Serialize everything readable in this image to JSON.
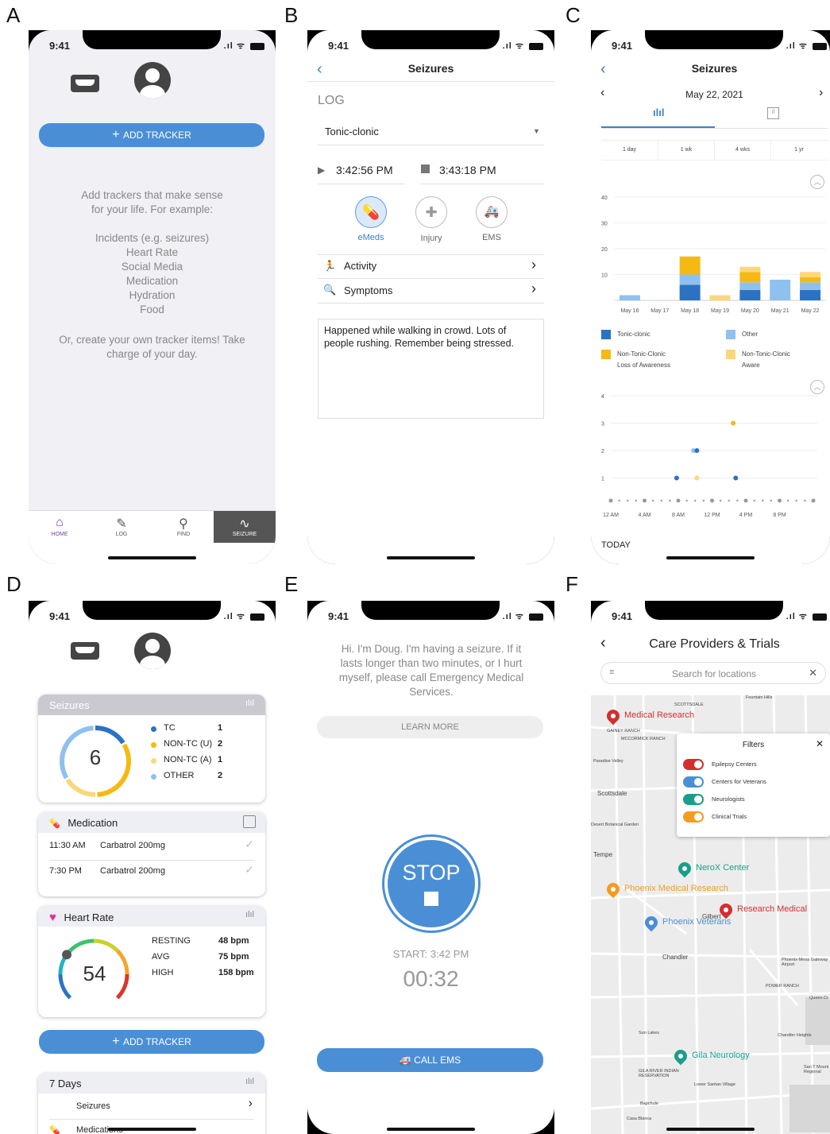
{
  "panels": {
    "a": "A",
    "b": "B",
    "c": "C",
    "d": "D",
    "e": "E",
    "f": "F"
  },
  "status": {
    "time": "9:41"
  },
  "screenA": {
    "add_tracker": "ADD TRACKER",
    "intro": "Add trackers that make sense",
    "intro2": "for your life. For example:",
    "examples": [
      "Incidents (e.g. seizures)",
      "Heart Rate",
      "Social Media",
      "Medication",
      "Hydration",
      "Food"
    ],
    "outro": "Or, create your own tracker items! Take",
    "outro2": "charge of your day.",
    "tabs": [
      "HOME",
      "LOG",
      "FIND",
      "SEIZURE"
    ]
  },
  "screenB": {
    "title": "Seizures",
    "log": "LOG",
    "type": "Tonic-clonic",
    "start": "3:42:56  PM",
    "end": "3:43:18  PM",
    "buttons": [
      "eMeds",
      "Injury",
      "EMS"
    ],
    "rows": [
      "Activity",
      "Symptoms"
    ],
    "note": "Happened while walking in crowd. Lots of people rushing. Remember being stressed."
  },
  "screenC": {
    "title": "Seizures",
    "date": "May 22, 2021",
    "ranges": [
      "1 day",
      "1 wk",
      "4 wks",
      "1 yr"
    ],
    "today": "TODAY",
    "legend": [
      {
        "label": "Tonic-clonic",
        "color": "#2b73c2"
      },
      {
        "label": "Other",
        "color": "#8ec1ee"
      },
      {
        "label": "Non-Tonic-Clonic",
        "label2": "Loss of Awareness",
        "color": "#f5b914"
      },
      {
        "label": "Non-Tonic-Clonic",
        "label2": "Aware",
        "color": "#fbd77c"
      }
    ]
  },
  "chart_data": [
    {
      "type": "bar",
      "categories": [
        "May 16",
        "May 17",
        "May 18",
        "May 19",
        "May 20",
        "May 21",
        "May 22"
      ],
      "ylim": [
        0,
        40
      ],
      "yticks": [
        10,
        20,
        30,
        40
      ],
      "series": [
        {
          "name": "Tonic-clonic",
          "values": [
            0,
            0,
            6,
            0,
            4,
            0,
            4
          ]
        },
        {
          "name": "Other",
          "values": [
            2,
            0,
            4,
            0,
            3,
            8,
            3
          ]
        },
        {
          "name": "Non-Tonic-Clonic Loss of Awareness",
          "values": [
            0,
            0,
            7,
            0,
            4,
            0,
            2
          ]
        },
        {
          "name": "Non-Tonic-Clonic Aware",
          "values": [
            0,
            0,
            0,
            2,
            2,
            0,
            2
          ]
        }
      ]
    },
    {
      "type": "scatter",
      "xticks": [
        "12 AM",
        "4 AM",
        "8 AM",
        "12 PM",
        "4 PM",
        "8 PM"
      ],
      "ylim": [
        0,
        4
      ],
      "yticks": [
        1,
        2,
        3,
        4
      ],
      "points": [
        {
          "x": 7.8,
          "y": 1,
          "series": "Tonic-clonic"
        },
        {
          "x": 10.2,
          "y": 1,
          "series": "Non-Tonic-Clonic Aware"
        },
        {
          "x": 9.8,
          "y": 2,
          "series": "Other"
        },
        {
          "x": 10.2,
          "y": 2,
          "series": "Tonic-clonic"
        },
        {
          "x": 14.5,
          "y": 3,
          "series": "Non-Tonic-Clonic Loss of Awareness"
        },
        {
          "x": 14.8,
          "y": 1,
          "series": "Tonic-clonic"
        }
      ]
    }
  ],
  "screenD": {
    "seizures": "Seizures",
    "seizure_count": "6",
    "seizure_rows": [
      {
        "label": "TC",
        "value": "1",
        "color": "#2b73c2"
      },
      {
        "label": "NON-TC (U)",
        "value": "2",
        "color": "#f5b914"
      },
      {
        "label": "NON-TC (A)",
        "value": "1",
        "color": "#fbd77c"
      },
      {
        "label": "OTHER",
        "value": "2",
        "color": "#8ec1ee"
      }
    ],
    "medication": "Medication",
    "meds": [
      {
        "time": "11:30 AM",
        "name": "Carbatrol 200mg"
      },
      {
        "time": "7:30 PM",
        "name": "Carbatrol 200mg"
      }
    ],
    "heart_rate": "Heart Rate",
    "hr_value": "54",
    "hr_rows": [
      {
        "label": "RESTING",
        "value": "48 bpm"
      },
      {
        "label": "AVG",
        "value": "75 bpm"
      },
      {
        "label": "HIGH",
        "value": "158 bpm"
      }
    ],
    "add_tracker": "ADD TRACKER",
    "seven_days": "7 Days",
    "seven_rows": [
      "Seizures",
      "Medications"
    ]
  },
  "screenE": {
    "message": "Hi. I'm Doug. I'm having a seizure. If it lasts longer than two minutes, or I hurt myself, please call Emergency Medical Services.",
    "learn_more": "LEARN MORE",
    "stop": "STOP",
    "start": "START: 3:42 PM",
    "timer": "00:32",
    "call": "CALL EMS"
  },
  "screenF": {
    "title": "Care Providers & Trials",
    "search_placeholder": "Search for locations",
    "filters_title": "Filters",
    "filters": [
      {
        "label": "Epilepsy Centers",
        "color": "#d32f2f"
      },
      {
        "label": "Centers for Veterans",
        "color": "#4a8fd6"
      },
      {
        "label": "Neurologists",
        "color": "#1a9e8c"
      },
      {
        "label": "Clinical Trials",
        "color": "#f39c21"
      }
    ],
    "places": [
      {
        "label": "Medical Research",
        "color": "#d32f2f"
      },
      {
        "label": "NeroX Center",
        "color": "#1a9e8c"
      },
      {
        "label": "Phoenix Medical Research",
        "color": "#f39c21"
      },
      {
        "label": "Research Medical",
        "color": "#d32f2f"
      },
      {
        "label": "Phoenix Veterans",
        "color": "#4a8fd6"
      },
      {
        "label": "Gila Neurology",
        "color": "#1a9e8c"
      }
    ],
    "map_labels": [
      "Fountain Hills",
      "Paradise Valley",
      "Scottsdale",
      "Desert Botanical Garden",
      "Tempe",
      "Gilbert",
      "Chandler",
      "Phoenix-Mesa Gateway Airport",
      "Sun Lakes",
      "Chandler Heights",
      "Queen Cr",
      "San T Mount Regional",
      "GILA RIVER INDIAN RESERVATION",
      "Lower Santan Village",
      "Bapchule",
      "Casa Blanca",
      "POWER RANCH",
      "SCOTTSDALE",
      "GAINEY RANCH",
      "MCCORMICK RANCH"
    ]
  }
}
